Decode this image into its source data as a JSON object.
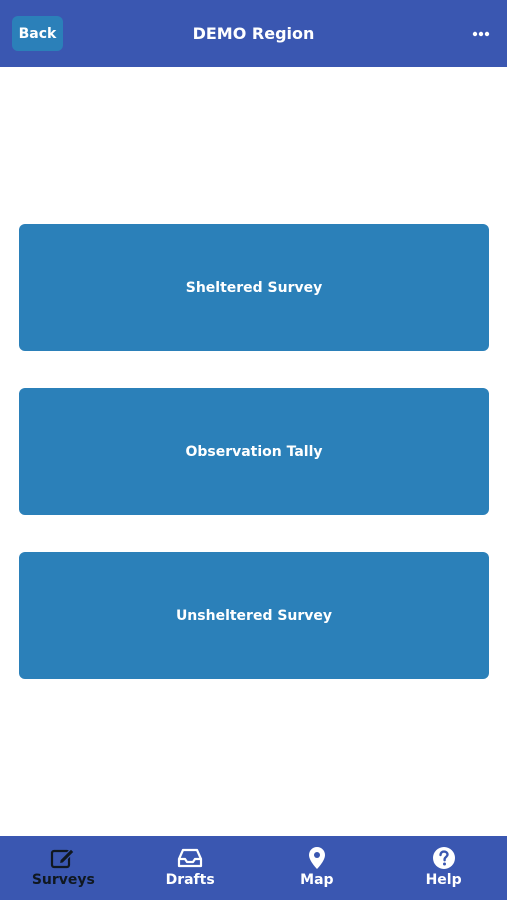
{
  "header": {
    "back_label": "Back",
    "title": "DEMO Region",
    "more_icon": "more-horizontal-icon"
  },
  "surveys": [
    {
      "label": "Sheltered Survey"
    },
    {
      "label": "Observation Tally"
    },
    {
      "label": "Unsheltered Survey"
    }
  ],
  "tabbar": {
    "active": "Surveys",
    "tabs": [
      {
        "label": "Surveys",
        "icon": "edit-icon"
      },
      {
        "label": "Drafts",
        "icon": "inbox-icon"
      },
      {
        "label": "Map",
        "icon": "map-pin-icon"
      },
      {
        "label": "Help",
        "icon": "help-icon"
      }
    ]
  },
  "colors": {
    "header_bg": "#3a57b1",
    "button_bg": "#2b80b9",
    "active_tab": "#101820",
    "text_light": "#ffffff"
  }
}
